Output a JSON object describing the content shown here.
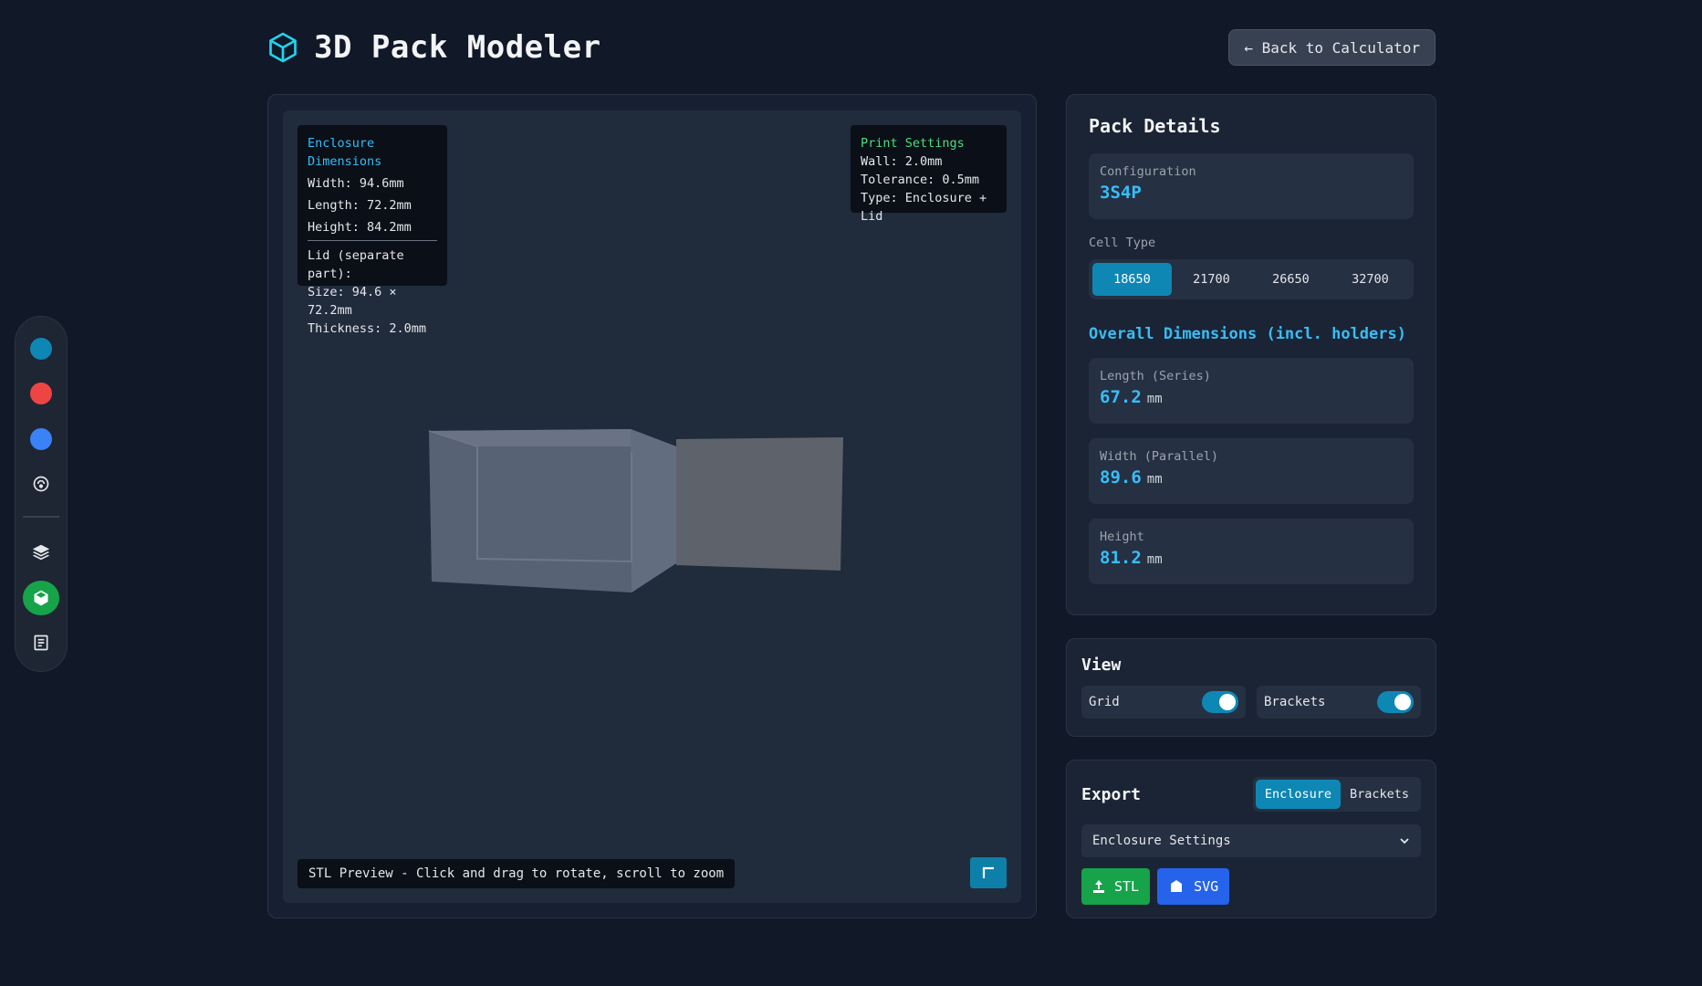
{
  "app": {
    "title": "3D Pack Modeler",
    "back_label": "← Back to Calculator"
  },
  "dock": {
    "items": [
      {
        "name": "teal-dot",
        "color": "#0e87b5"
      },
      {
        "name": "red-dot",
        "color": "#ef4444"
      },
      {
        "name": "blue-dot",
        "color": "#3b82f6"
      }
    ]
  },
  "viewer": {
    "enclosure": {
      "heading": "Enclosure Dimensions",
      "width": "Width: 94.6mm",
      "length": "Length: 72.2mm",
      "height": "Height: 84.2mm",
      "lid_title": "Lid (separate part):",
      "lid_size": "Size: 94.6 × 72.2mm",
      "lid_thickness": "Thickness: 2.0mm"
    },
    "print": {
      "heading": "Print Settings",
      "wall": "Wall: 2.0mm",
      "tolerance": "Tolerance: 0.5mm",
      "type": "Type: Enclosure + Lid"
    },
    "hint": "STL Preview - Click and drag to rotate, scroll to zoom"
  },
  "pack": {
    "title": "Pack Details",
    "configuration_label": "Configuration",
    "configuration_value": "3S4P",
    "cell_type_label": "Cell Type",
    "cell_types": [
      "18650",
      "21700",
      "26650",
      "32700"
    ],
    "overall_title": "Overall Dimensions (incl. holders)",
    "length_label": "Length (Series)",
    "length_value": "67.2",
    "width_label": "Width (Parallel)",
    "width_value": "89.6",
    "height_label": "Height",
    "height_value": "81.2",
    "unit": "mm"
  },
  "view": {
    "title": "View",
    "grid_label": "Grid",
    "brackets_label": "Brackets"
  },
  "export": {
    "title": "Export",
    "tab_enclosure": "Enclosure",
    "tab_brackets": "Brackets",
    "settings_label": "Enclosure Settings",
    "stl_label": "STL",
    "svg_label": "SVG"
  }
}
